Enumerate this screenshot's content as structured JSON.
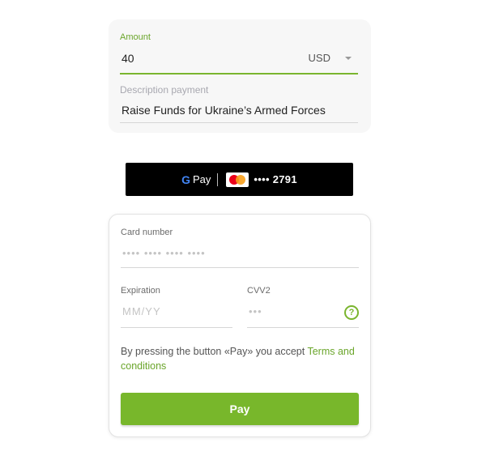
{
  "donation": {
    "amount_label": "Amount",
    "amount_value": "40",
    "currency": "USD",
    "description_label": "Description payment",
    "description_value": "Raise Funds for Ukraine’s Armed Forces"
  },
  "google_pay": {
    "g_letter": "G",
    "pay_text": "Pay",
    "card_brand_icon": "mastercard-icon",
    "card_mask": "•••• 2791"
  },
  "card_form": {
    "card_number_label": "Card number",
    "card_number_placeholder": "•••• •••• •••• ••••",
    "expiration_label": "Expiration",
    "expiration_placeholder": "MM/YY",
    "cvv_label": "CVV2",
    "cvv_placeholder": "•••",
    "help_icon": "?",
    "terms_prefix": "By pressing the button «Pay» you accept ",
    "terms_link": "Terms and conditions",
    "pay_button": "Pay"
  },
  "colors": {
    "accent": "#78b72b",
    "gpay_background": "#000000"
  }
}
